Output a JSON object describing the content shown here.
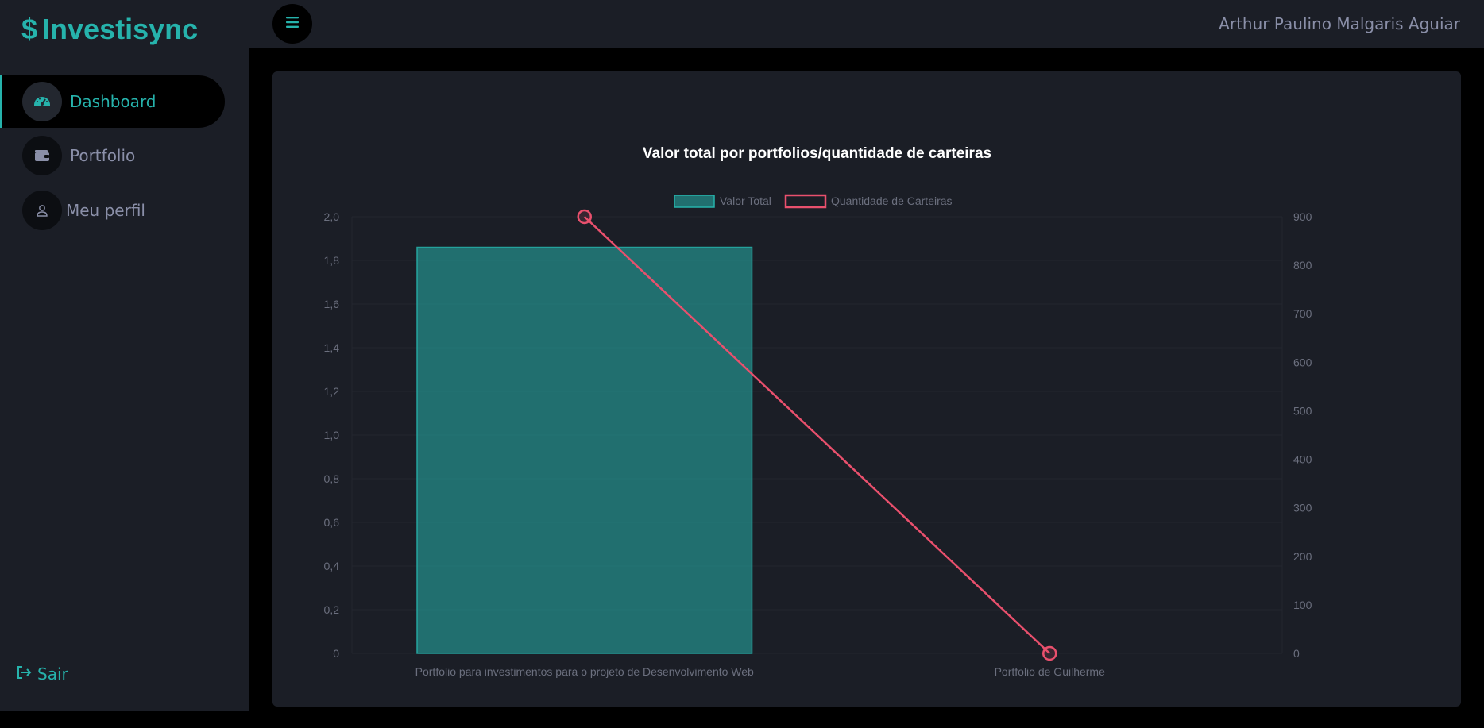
{
  "app": {
    "name": "Investisync",
    "logo_symbol": "$",
    "brand_color": "#26b3ac"
  },
  "sidebar": {
    "items": [
      {
        "label": "Dashboard",
        "icon": "speedometer-icon",
        "active": true
      },
      {
        "label": "Portfolio",
        "icon": "wallet-icon",
        "active": false
      },
      {
        "label": "Meu perfil",
        "icon": "person-icon",
        "active": false
      }
    ],
    "logout_label": "Sair",
    "logout_icon": "logout-icon"
  },
  "header": {
    "menu_icon": "hamburger-icon",
    "user_name": "Arthur Paulino Malgaris Aguiar"
  },
  "chart_data": {
    "type": "bar",
    "title": "Valor total por portfolios/quantidade de carteiras",
    "categories": [
      "Portfolio para investimentos para o projeto de Desenvolvimento Web",
      "Portfolio de Guilherme"
    ],
    "series": [
      {
        "name": "Valor Total",
        "type": "bar",
        "axis": "left",
        "values": [
          1.86,
          0
        ],
        "color": "#26b3ac"
      },
      {
        "name": "Quantidade de Carteiras",
        "type": "line",
        "axis": "right",
        "values": [
          900,
          0
        ],
        "color": "#e9506d"
      }
    ],
    "y_left": {
      "min": 0,
      "max": 2.0,
      "ticks": [
        "0",
        "0,2",
        "0,4",
        "0,6",
        "0,8",
        "1,0",
        "1,2",
        "1,4",
        "1,6",
        "1,8",
        "2,0"
      ]
    },
    "y_right": {
      "min": 0,
      "max": 900,
      "ticks": [
        "0",
        "100",
        "200",
        "300",
        "400",
        "500",
        "600",
        "700",
        "800",
        "900"
      ]
    },
    "legend": "top-center",
    "grid": true
  }
}
